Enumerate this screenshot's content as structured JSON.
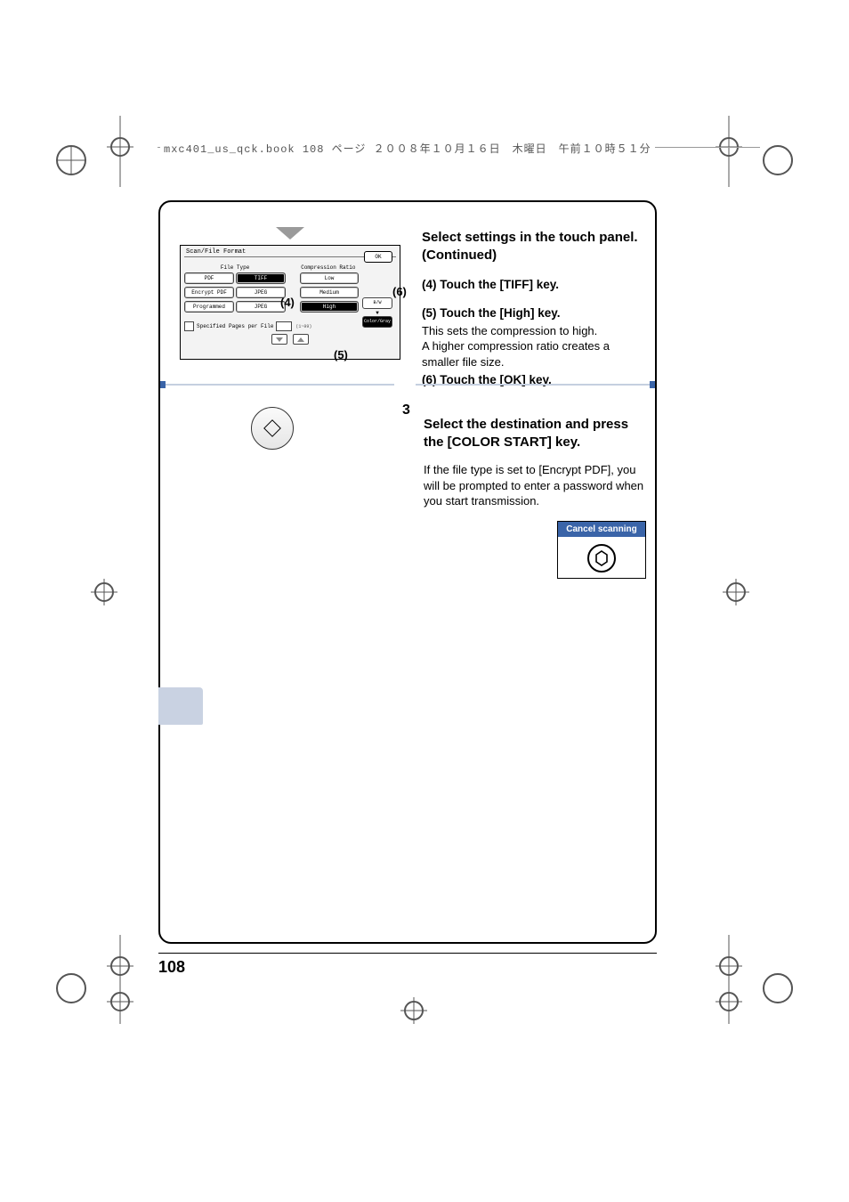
{
  "header": {
    "text": "mxc401_us_qck.book  108 ページ  ２００８年１０月１６日　木曜日　午前１０時５１分"
  },
  "panel": {
    "title": "Scan/File Format",
    "ok": "OK",
    "file_type_label": "File Type",
    "compression_label": "Compression Ratio",
    "file_types_col1": [
      "PDF",
      "Encrypt PDF",
      "Programmed"
    ],
    "file_types_col2": [
      "TIFF",
      "JPEG",
      "JPEG"
    ],
    "compressions": [
      "Low",
      "Medium",
      "High"
    ],
    "side": {
      "bw": "B/W",
      "colorgray": "Color/Gray"
    },
    "spf": {
      "label": "Specified Pages per File",
      "range": "(1~99)"
    }
  },
  "callouts": {
    "c4": "(4)",
    "c5": "(5)",
    "c6": "(6)"
  },
  "right": {
    "heading": "Select settings in the touch panel. (Continued)",
    "s4": "(4) Touch the [TIFF] key.",
    "s5": "(5) Touch the [High] key.",
    "s5a": "This sets the compression to high.",
    "s5b": "A higher compression ratio creates a smaller file size.",
    "s6": "(6) Touch the [OK] key."
  },
  "step3": {
    "num": "3",
    "heading": "Select the destination and press the [COLOR START] key.",
    "body": "If the file type is set to [Encrypt PDF], you will be prompted to enter a password when you start transmission.",
    "cancel": "Cancel scanning"
  },
  "page_number": "108"
}
